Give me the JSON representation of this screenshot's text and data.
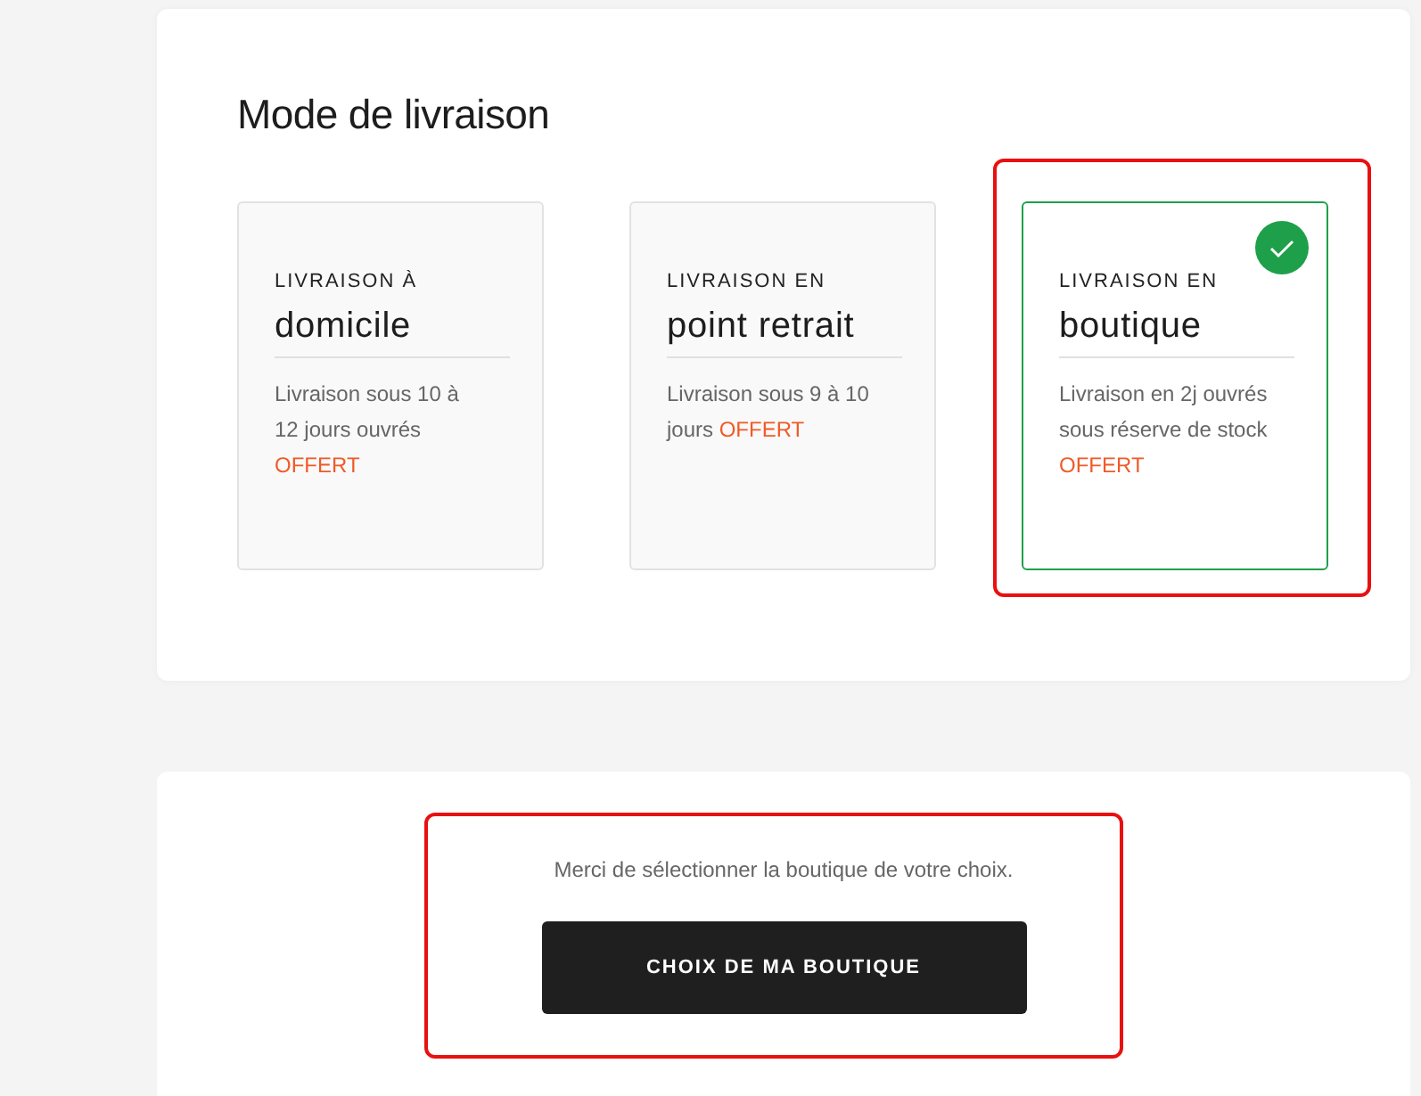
{
  "delivery": {
    "title": "Mode de livraison",
    "options": [
      {
        "eyebrow": "LIVRAISON À",
        "name": "domicile",
        "description": "Livraison sous 10 à 12 jours ouvrés",
        "price": "OFFERT",
        "selected": false,
        "highlighted": false
      },
      {
        "eyebrow": "LIVRAISON EN",
        "name": "point retrait",
        "description": "Livraison sous 9 à 10 jours",
        "price": "OFFERT",
        "selected": false,
        "highlighted": false
      },
      {
        "eyebrow": "LIVRAISON EN",
        "name": "boutique",
        "description": "Livraison en 2j ouvrés sous réserve de stock",
        "price": "OFFERT",
        "selected": true,
        "highlighted": true
      }
    ]
  },
  "store": {
    "message": "Merci de sélectionner la boutique de votre choix.",
    "button": "CHOIX DE MA BOUTIQUE",
    "highlighted": true
  }
}
